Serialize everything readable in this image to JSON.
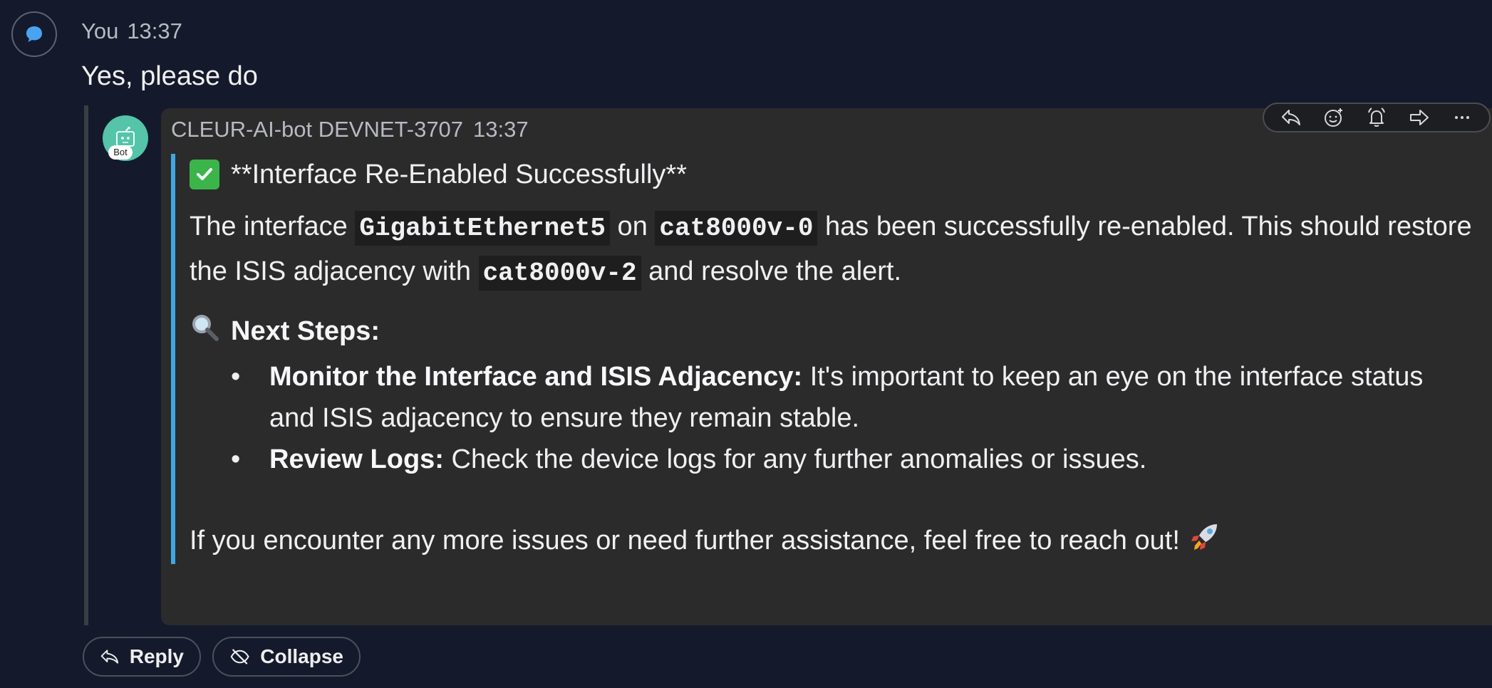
{
  "user_message": {
    "author": "You",
    "time": "13:37",
    "text": "Yes, please do"
  },
  "bot_message": {
    "author": "CLEUR-AI-bot DEVNET-3707",
    "time": "13:37",
    "badge": "Bot",
    "heading": "**Interface Re-Enabled Successfully**",
    "para1_a": "The interface ",
    "code_interface": "GigabitEthernet5",
    "para1_b": " on ",
    "code_device": "cat8000v-0",
    "para1_c": " has been successfully re-enabled. This should restore the ISIS adjacency with ",
    "code_peer": "cat8000v-2",
    "para1_d": " and resolve the alert.",
    "steps_title": "Next Steps:",
    "steps": [
      {
        "bold": "Monitor the Interface and ISIS Adjacency:",
        "text": " It's important to keep an eye on the interface status and ISIS adjacency to ensure they remain stable."
      },
      {
        "bold": "Review Logs:",
        "text": " Check the device logs for any further anomalies or issues."
      }
    ],
    "closing": "If you encounter any more issues or need further assistance, feel free to reach out!"
  },
  "toolbar": {
    "icons": [
      "reply-icon",
      "add-reaction-icon",
      "alert-bell-icon",
      "forward-icon",
      "more-icon"
    ]
  },
  "actions": {
    "reply_label": "Reply",
    "collapse_label": "Collapse"
  },
  "colors": {
    "background": "#141a2b",
    "card": "#2b2b2c",
    "quote_accent": "#3fa7e4",
    "bot_avatar": "#55c4a9"
  }
}
